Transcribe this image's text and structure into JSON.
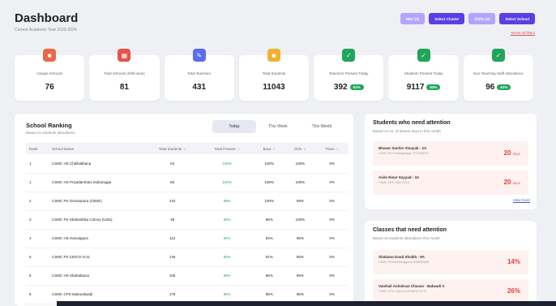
{
  "header": {
    "title": "Dashboard",
    "subtitle": "Current Academic Year 2023-2024"
  },
  "buttons": [
    {
      "label": "HRC (2)",
      "style": "light"
    },
    {
      "label": "Select Cluster",
      "style": "dark"
    },
    {
      "label": "Shifts (2)",
      "style": "light"
    },
    {
      "label": "Select School",
      "style": "dark"
    }
  ],
  "reset_label": "Reset all filters",
  "stats": [
    {
      "label": "Unique Schools",
      "value": "76",
      "color": "#e8684a",
      "icon": "school-icon"
    },
    {
      "label": "Total Schools (Shift-wise)",
      "value": "81",
      "color": "#e8524a",
      "icon": "building-icon"
    },
    {
      "label": "Total Teachers",
      "value": "431",
      "color": "#5b6cf0",
      "icon": "teacher-icon"
    },
    {
      "label": "Total Students",
      "value": "11043",
      "color": "#f0b030",
      "icon": "students-icon"
    },
    {
      "label": "Teachers Present Today",
      "value": "392",
      "pill": "91%",
      "color": "#1fa65a",
      "icon": "check-icon"
    },
    {
      "label": "Students Present Today",
      "value": "9117",
      "pill": "83%",
      "color": "#1fa65a",
      "icon": "check-icon"
    },
    {
      "label": "Non-Teaching Staff Attendance",
      "value": "96",
      "pill": "91%",
      "color": "#1fa65a",
      "icon": "check-icon"
    }
  ],
  "ranking": {
    "title": "School Ranking",
    "subtitle": "Based on students attendance",
    "tabs": [
      "Today",
      "This Week",
      "This Month"
    ],
    "columns": [
      "Rank",
      "School Name",
      "Total Students",
      "Total Present",
      "Boys",
      "Girls",
      "Trans"
    ],
    "rows": [
      [
        "1",
        "CSMC HS Chikhalthana",
        "63",
        "100%",
        "100%",
        "100%",
        "0%"
      ],
      [
        "1",
        "CSMC HS Priyadarshani Indiranagar",
        "83",
        "100%",
        "100%",
        "100%",
        "0%"
      ],
      [
        "2",
        "CSMC PS Osmanpura (CBSE)",
        "142",
        "99%",
        "100%",
        "99%",
        "0%"
      ],
      [
        "3",
        "CSMC PS Shahashika Colony (Urdu)",
        "39",
        "95%",
        "86%",
        "100%",
        "0%"
      ],
      [
        "4",
        "CSMC HS Harsulgaon",
        "112",
        "94%",
        "94%",
        "95%",
        "0%"
      ],
      [
        "5",
        "CSMC PS CIDCO N-11",
        "146",
        "93%",
        "91%",
        "95%",
        "0%"
      ],
      [
        "6",
        "CSMC HS Shahabazar",
        "105",
        "96%",
        "96%",
        "96%",
        "0%"
      ],
      [
        "6",
        "CSMC CPS Mukundwadi",
        "175",
        "95%",
        "95%",
        "96%",
        "0%"
      ]
    ]
  },
  "students_attention": {
    "title": "Students who need attention",
    "subtitle": "Based on no. of absent days in this month",
    "entries": [
      {
        "name": "Bhavar Sachin Vinayak - 2A",
        "detail": "CSMC PS Pundlingnagar 7270744073",
        "value": "20",
        "unit": "days"
      },
      {
        "name": "Asim Nisar Sayyad - 3A",
        "detail": "CSMC CPS CIDCO N-4",
        "value": "20",
        "unit": "days"
      }
    ],
    "view_more": "View more"
  },
  "classes_attention": {
    "title": "Classes that need attention",
    "subtitle": "Based on students attendance this month",
    "entries": [
      {
        "name": "Shahana Daud Shaikh - 8A",
        "detail": "CSMC PS Aref Rangipura 9096800826",
        "value": "14%"
      },
      {
        "name": "Vaishali Ashokrao Chavan - Balwadi A",
        "detail": "CSMC CPS CIDCO N-8 8657274774",
        "value": "26%"
      }
    ]
  }
}
